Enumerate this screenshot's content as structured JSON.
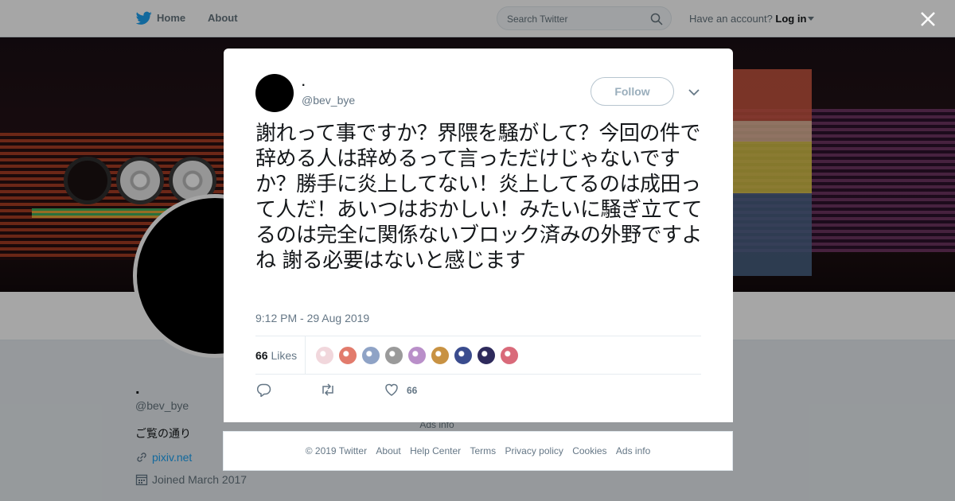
{
  "topbar": {
    "home_label": "Home",
    "about_label": "About",
    "search_placeholder": "Search Twitter",
    "account_prompt": "Have an account?",
    "login_label": "Log in"
  },
  "profile": {
    "name": ".",
    "handle": "@bev_bye",
    "bio": "ご覧の通り",
    "link": "pixiv.net",
    "joined": "Joined March 2017"
  },
  "background_ads": "Ads info",
  "tweet": {
    "name": ".",
    "handle": "@bev_bye",
    "follow_label": "Follow",
    "text": "謝れって事ですか？界隈を騒がして？今回の件で辞める人は辞めるって言っただけじゃないですか？勝手に炎上してない！炎上してるのは成田って人だ！あいつはおかしい！みたいに騒ぎ立ててるのは完全に関係ないブロック済みの外野ですよね 謝る必要はないと感じます",
    "timestamp": "9:12 PM - 29 Aug 2019",
    "likes_number": "66",
    "likes_label": "Likes",
    "like_count": "66",
    "liker_avatars": [
      "#f1d7dc",
      "#e27b6c",
      "#8fa3c6",
      "#9a9a9a",
      "#b98fc9",
      "#c89243",
      "#3a4c8e",
      "#2e2a5c",
      "#d96a7a"
    ]
  },
  "footer": {
    "copyright": "© 2019 Twitter",
    "about": "About",
    "help": "Help Center",
    "terms": "Terms",
    "privacy": "Privacy policy",
    "cookies": "Cookies",
    "ads": "Ads info"
  },
  "colors": {
    "brand": "#1da1f2",
    "text": "#14171a",
    "muted": "#657786"
  }
}
